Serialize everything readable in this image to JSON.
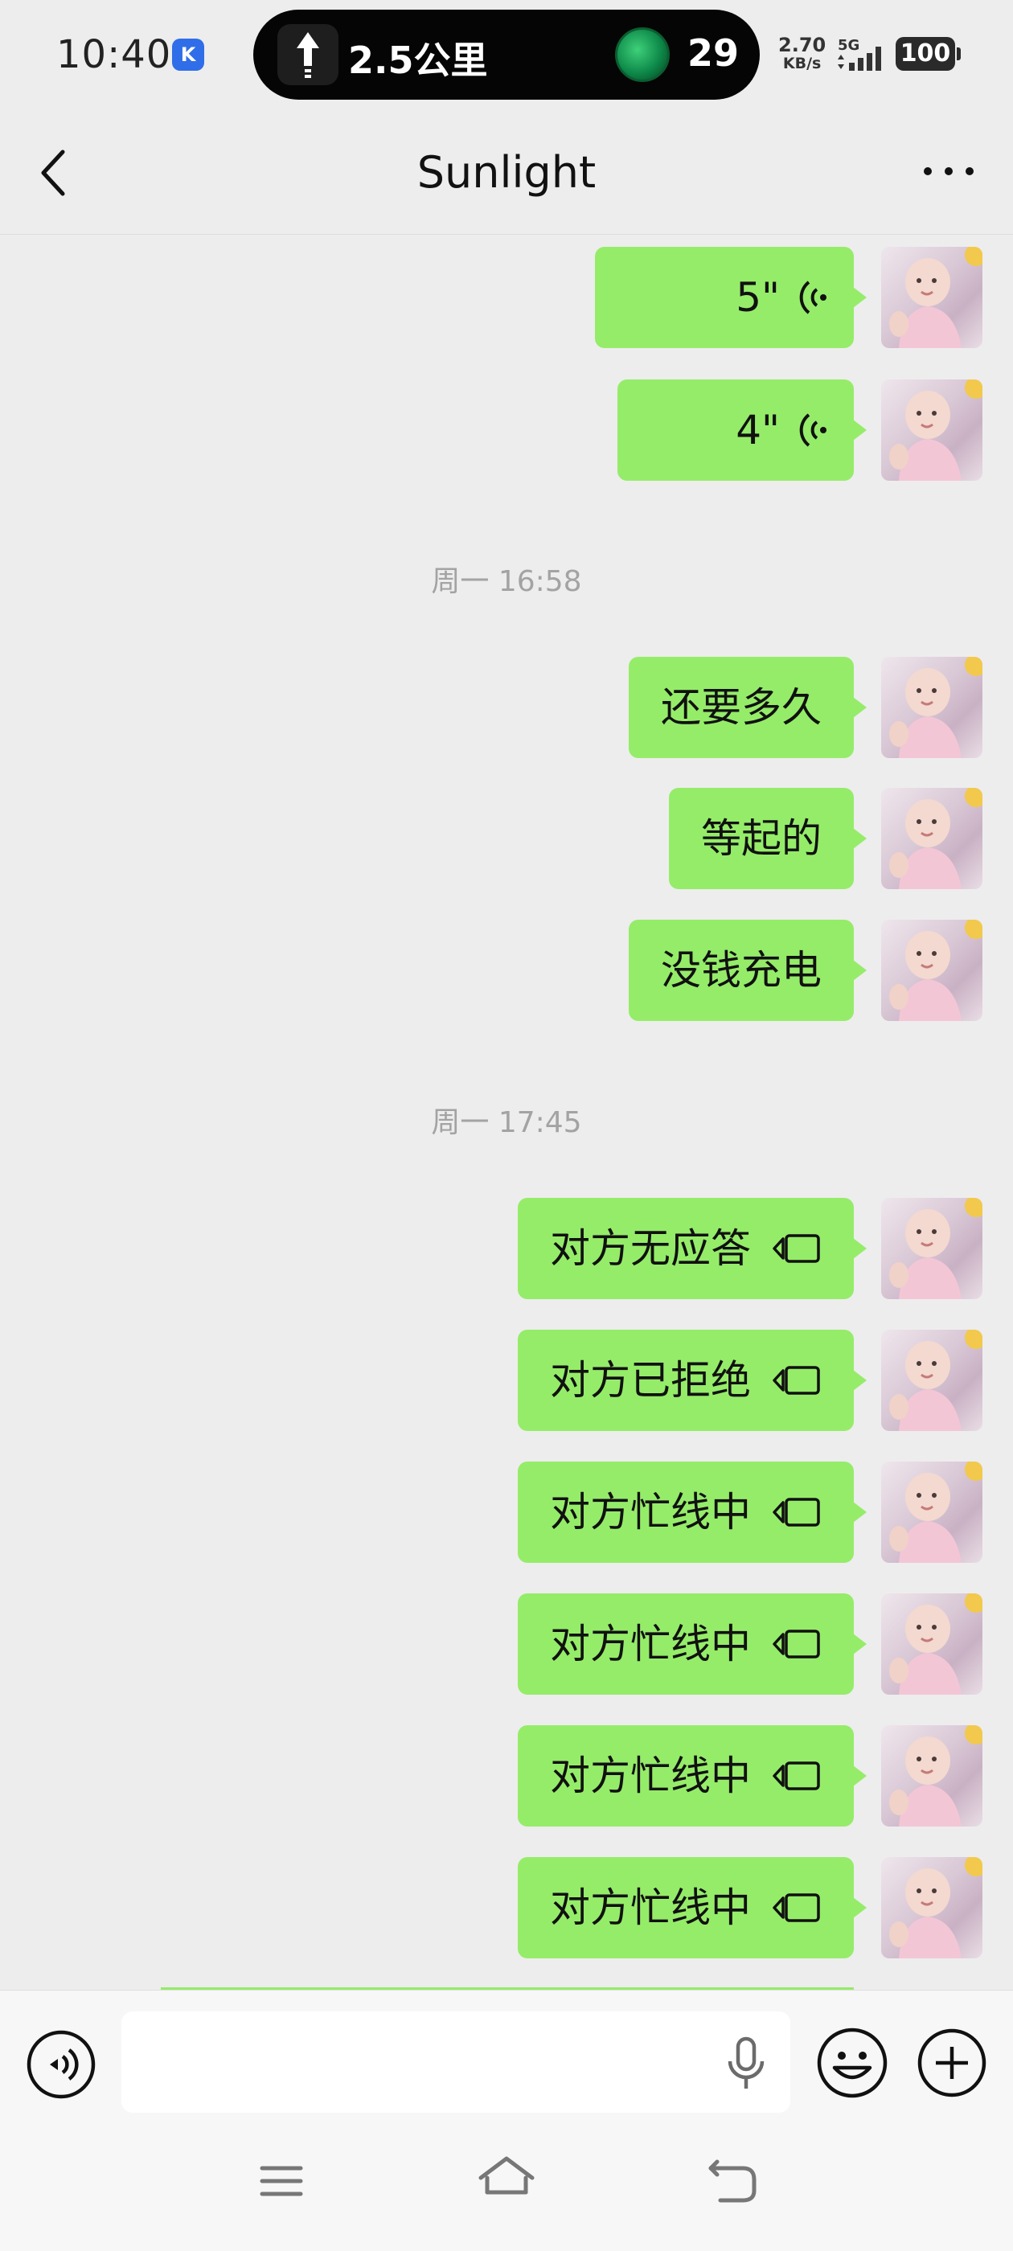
{
  "status_bar": {
    "time": "10:40",
    "k_badge": "K",
    "island_distance": "2.5公里",
    "island_count": "29",
    "net_speed_value": "2.70",
    "net_speed_unit": "KB/s",
    "network": "5G",
    "battery": "100"
  },
  "header": {
    "title": "Sunlight",
    "back_icon": "chevron-left-icon",
    "more_icon": "more-horizontal-icon"
  },
  "messages": [
    {
      "type": "voice",
      "label": "5\"",
      "icon": "voice-wave-icon"
    },
    {
      "type": "voice",
      "label": "4\"",
      "icon": "voice-wave-icon"
    },
    {
      "type": "time",
      "label": "周一 16:58"
    },
    {
      "type": "text",
      "label": "还要多久"
    },
    {
      "type": "text",
      "label": "等起的"
    },
    {
      "type": "text",
      "label": "没钱充电"
    },
    {
      "type": "time",
      "label": "周一 17:45"
    },
    {
      "type": "call",
      "label": "对方无应答",
      "icon": "video-call-icon"
    },
    {
      "type": "call",
      "label": "对方已拒绝",
      "icon": "video-call-icon"
    },
    {
      "type": "call",
      "label": "对方忙线中",
      "icon": "video-call-icon"
    },
    {
      "type": "call",
      "label": "对方忙线中",
      "icon": "video-call-icon"
    },
    {
      "type": "call",
      "label": "对方忙线中",
      "icon": "video-call-icon"
    },
    {
      "type": "call",
      "label": "对方忙线中",
      "icon": "video-call-icon"
    }
  ],
  "input_bar": {
    "placeholder": "",
    "voice_icon": "voice-toggle-icon",
    "mic_icon": "microphone-icon",
    "emoji_icon": "emoji-icon",
    "plus_icon": "plus-icon"
  },
  "colors": {
    "bubble": "#95ec69",
    "background": "#ededed",
    "input_bar": "#f7f7f7"
  }
}
